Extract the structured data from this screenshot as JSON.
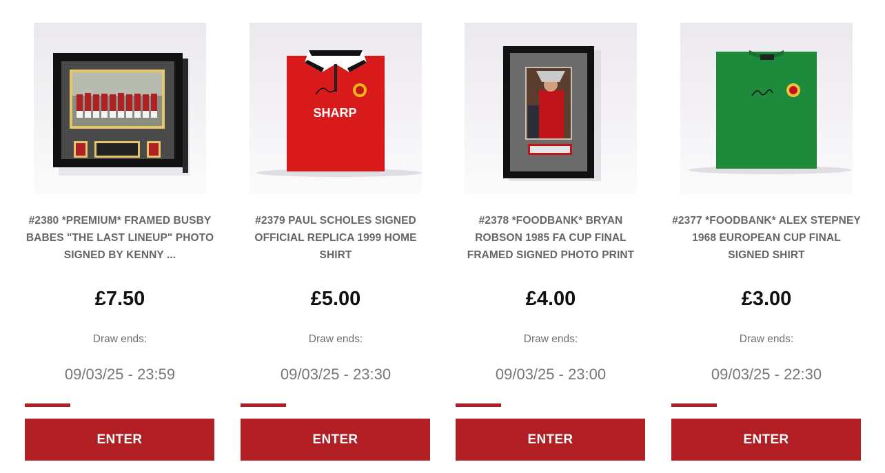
{
  "products": [
    {
      "title": "#2380 *PREMIUM* FRAMED BUSBY BABES \"THE LAST LINEUP\" PHOTO SIGNED BY KENNY ...",
      "image_icon": "framed-team-photo",
      "price": "£7.50",
      "draw_label": "Draw ends:",
      "draw_date": "09/03/25 - 23:59",
      "button_label": "ENTER"
    },
    {
      "title": "#2379 PAUL SCHOLES SIGNED OFFICIAL REPLICA 1999 HOME SHIRT",
      "image_icon": "red-shirt",
      "image_text": "SHARP",
      "price": "£5.00",
      "draw_label": "Draw ends:",
      "draw_date": "09/03/25 - 23:30",
      "button_label": "ENTER"
    },
    {
      "title": "#2378 *FOODBANK* BRYAN ROBSON 1985 FA CUP FINAL FRAMED SIGNED PHOTO PRINT",
      "image_icon": "framed-photo-print",
      "price": "£4.00",
      "draw_label": "Draw ends:",
      "draw_date": "09/03/25 - 23:00",
      "button_label": "ENTER"
    },
    {
      "title": "#2377 *FOODBANK* ALEX STEPNEY 1968 EUROPEAN CUP FINAL SIGNED SHIRT",
      "image_icon": "green-shirt",
      "price": "£3.00",
      "draw_label": "Draw ends:",
      "draw_date": "09/03/25 - 22:30",
      "button_label": "ENTER"
    }
  ],
  "colors": {
    "accent": "#b11e23",
    "title_text": "#666666",
    "price_text": "#111111",
    "date_text": "#777777"
  }
}
